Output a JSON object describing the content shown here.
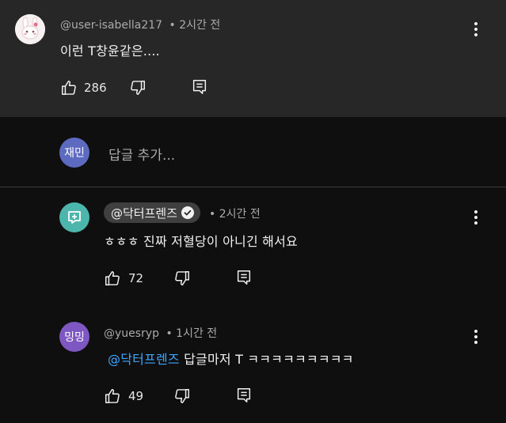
{
  "comment1": {
    "author": "@user-isabella217",
    "time": "• 2시간 전",
    "text": "이런  T창윤같은....",
    "likes": "286",
    "avatar_icon": "bunny-avatar-icon"
  },
  "add_reply": {
    "avatar_label": "재민",
    "avatar_color": "#5c6bc0",
    "placeholder": "답글 추가..."
  },
  "reply1": {
    "author": "@닥터프렌즈",
    "verified_icon": "verified-check-icon",
    "time": "• 2시간 전",
    "text": "ㅎㅎㅎ 진짜 저혈당이 아니긴 해서요",
    "likes": "72",
    "avatar_color": "#4db6ac"
  },
  "reply2": {
    "author": "@yuesryp",
    "time": "• 1시간 전",
    "mention": "@닥터프렌즈",
    "text": " 답글마저 T ㅋㅋㅋㅋㅋㅋㅋㅋㅋ",
    "likes": "49",
    "avatar_label": "밍밍",
    "avatar_color": "#7e57c2"
  },
  "colors": {
    "background": "#0f0f0f",
    "highlight_background": "#272727",
    "link": "#3ea6ff"
  }
}
